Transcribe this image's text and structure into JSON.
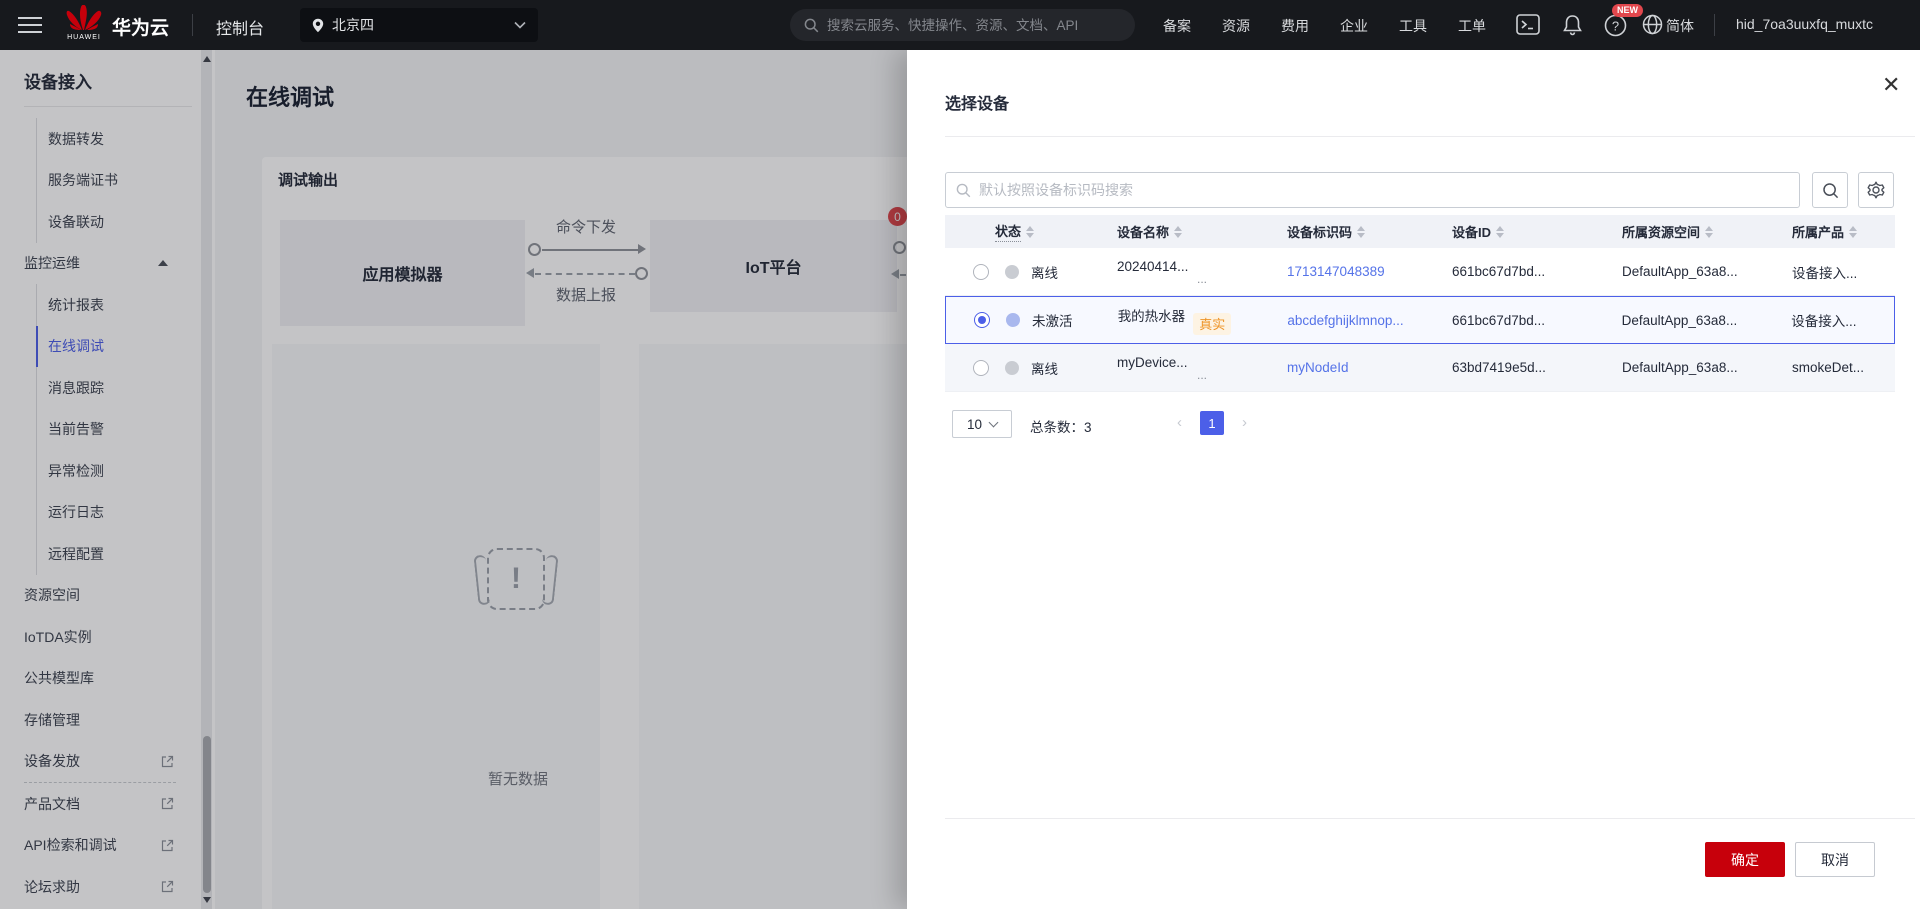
{
  "colors": {
    "accent": "#4c5fe8",
    "link": "#5573e8",
    "danger": "#c7000b",
    "badge_red": "#e2474d",
    "dot_inactive": "#a9b8ee",
    "dot_offline": "#c9ccd2",
    "tag_orange": "#ee9426",
    "tag_bg": "#fdf3e3"
  },
  "topbar": {
    "brand": "华为云",
    "brand_logo": "HUAWEI",
    "console_label": "控制台",
    "region": "北京四",
    "search_placeholder": "搜索云服务、快捷操作、资源、文档、API",
    "links": [
      "备案",
      "资源",
      "费用",
      "企业",
      "工具",
      "工单"
    ],
    "new_badge": "NEW",
    "language": "简体",
    "username": "hid_7oa3uuxfq_muxtc"
  },
  "sidebar": {
    "title": "设备接入",
    "items": [
      {
        "label": "数据转发",
        "type": "sub"
      },
      {
        "label": "服务端证书",
        "type": "sub"
      },
      {
        "label": "设备联动",
        "type": "sub"
      },
      {
        "label": "监控运维",
        "type": "group",
        "expanded": true
      },
      {
        "label": "统计报表",
        "type": "sub"
      },
      {
        "label": "在线调试",
        "type": "sub",
        "active": true
      },
      {
        "label": "消息跟踪",
        "type": "sub"
      },
      {
        "label": "当前告警",
        "type": "sub"
      },
      {
        "label": "异常检测",
        "type": "sub"
      },
      {
        "label": "运行日志",
        "type": "sub"
      },
      {
        "label": "远程配置",
        "type": "sub"
      },
      {
        "label": "资源空间",
        "type": "top"
      },
      {
        "label": "IoTDA实例",
        "type": "top"
      },
      {
        "label": "公共模型库",
        "type": "top"
      },
      {
        "label": "存储管理",
        "type": "top"
      },
      {
        "label": "设备发放",
        "type": "top",
        "external": true
      },
      {
        "type": "divider"
      },
      {
        "label": "产品文档",
        "type": "top",
        "external": true
      },
      {
        "label": "API检索和调试",
        "type": "top",
        "external": true
      },
      {
        "label": "论坛求助",
        "type": "top",
        "external": true
      }
    ]
  },
  "main": {
    "page_title": "在线调试",
    "panel_title": "调试输出",
    "diagram": {
      "app_box": "应用模拟器",
      "iot_box": "IoT平台",
      "command_label": "命令下发",
      "report_label": "数据上报",
      "badge_count": "0",
      "empty_text": "暂无数据"
    }
  },
  "dialog": {
    "title": "选择设备",
    "search_placeholder": "默认按照设备标识码搜索",
    "table": {
      "columns": [
        "状态",
        "设备名称",
        "设备标识码",
        "设备ID",
        "所属资源空间",
        "所属产品"
      ],
      "rows": [
        {
          "status": "离线",
          "name": "20240414...",
          "name_sub": "...",
          "tag": "",
          "code": "1713147048389",
          "device_id": "661bc67d7bd...",
          "resource_space": "DefaultApp_63a8...",
          "product": "设备接入...",
          "selected": false,
          "dot": "offline"
        },
        {
          "status": "未激活",
          "name": "我的热水器",
          "name_sub": "",
          "tag": "真实",
          "code": "abcdefghijklmnop...",
          "device_id": "661bc67d7bd...",
          "resource_space": "DefaultApp_63a8...",
          "product": "设备接入...",
          "selected": true,
          "dot": "inactive"
        },
        {
          "status": "离线",
          "name": "myDevice...",
          "name_sub": "...",
          "tag": "",
          "code": "myNodeId",
          "device_id": "63bd7419e5d...",
          "resource_space": "DefaultApp_63a8...",
          "product": "smokeDet...",
          "selected": false,
          "dot": "offline"
        }
      ]
    },
    "pagination": {
      "page_size": "10",
      "total_label": "总条数：",
      "total": "3",
      "current_page": "1"
    },
    "confirm_label": "确定",
    "cancel_label": "取消"
  }
}
